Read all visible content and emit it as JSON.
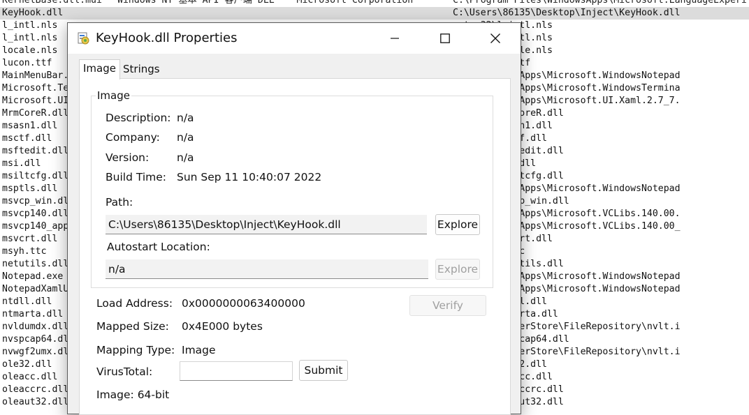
{
  "background_list": {
    "top_row": {
      "name": "KernelBase.dll.mui",
      "description": "Windows NT 基本 API 客户端 DLL",
      "company": "Microsoft Corporation",
      "path": "C:\\Program Files\\WindowsApps\\Microsoft.LanguageExperi"
    },
    "rows": [
      {
        "name": "KeyHook.dll",
        "path": "C:\\Users\\86135\\Desktop\\Inject\\KeyHook.dll",
        "selected": true
      },
      {
        "name": "l_intl.nls",
        "path": "ystem32\\l_intl.nls"
      },
      {
        "name": "l_intl.nls",
        "path": "ystem32\\l_intl.nls"
      },
      {
        "name": "locale.nls",
        "path": "ystem32\\locale.nls"
      },
      {
        "name": "lucon.ttf",
        "path": "onts\\lucon.ttf"
      },
      {
        "name": "MainMenuBar.",
        "path": "iles\\WindowsApps\\Microsoft.WindowsNotepad"
      },
      {
        "name": "Microsoft.Te",
        "path": "iles\\WindowsApps\\Microsoft.WindowsTermina"
      },
      {
        "name": "Microsoft.UI",
        "path": "iles\\WindowsApps\\Microsoft.UI.Xaml.2.7_7."
      },
      {
        "name": "MrmCoreR.dll",
        "path": "ystem32\\MrmCoreR.dll"
      },
      {
        "name": "msasn1.dll",
        "path": "ystem32\\msasn1.dll"
      },
      {
        "name": "msctf.dll",
        "path": "ystem32\\msctf.dll"
      },
      {
        "name": "msftedit.dll",
        "path": "ystem32\\msftedit.dll"
      },
      {
        "name": "msi.dll",
        "path": "ystem32\\msi.dll"
      },
      {
        "name": "msiltcfg.dll",
        "path": "ystem32\\msiltcfg.dll"
      },
      {
        "name": "msptls.dll",
        "path": "iles\\WindowsApps\\Microsoft.WindowsNotepad"
      },
      {
        "name": "msvcp_win.dl",
        "path": "ystem32\\msvcp_win.dll"
      },
      {
        "name": "msvcp140.dll",
        "path": "iles\\WindowsApps\\Microsoft.VCLibs.140.00."
      },
      {
        "name": "msvcp140_app",
        "path": "iles\\WindowsApps\\Microsoft.VCLibs.140.00_"
      },
      {
        "name": "msvcrt.dll",
        "path": "ystem32\\msvcrt.dll"
      },
      {
        "name": "msyh.ttc",
        "path": "onts\\msyh.ttc"
      },
      {
        "name": "netutils.dll",
        "path": "ystem32\\netutils.dll"
      },
      {
        "name": "Notepad.exe",
        "path": "iles\\WindowsApps\\Microsoft.WindowsNotepad"
      },
      {
        "name": "NotepadXamlU",
        "path": "iles\\WindowsApps\\Microsoft.WindowsNotepad"
      },
      {
        "name": "ntdll.dll",
        "path": "ystem32\\ntdll.dll"
      },
      {
        "name": "ntmarta.dll",
        "path": "ystem32\\ntmarta.dll"
      },
      {
        "name": "nvldumdx.dll",
        "path": "ystem32\\DriverStore\\FileRepository\\nvlt.i"
      },
      {
        "name": "nvspcap64.dl",
        "path": "ystem32\\nvspcap64.dll"
      },
      {
        "name": "nvwgf2umx.dl",
        "path": "ystem32\\DriverStore\\FileRepository\\nvlt.i"
      },
      {
        "name": "ole32.dll",
        "path": "ystem32\\ole32.dll"
      },
      {
        "name": "oleacc.dll",
        "path": "ystem32\\oleacc.dll"
      },
      {
        "name": "oleaccrc.dll",
        "path": "ystem32\\oleaccrc.dll"
      },
      {
        "name": "oleaut32.dll",
        "path": "ystem32\\oleaut32.dll"
      }
    ]
  },
  "dialog": {
    "title": "KeyHook.dll Properties",
    "tabs": [
      {
        "label": "Image",
        "active": true
      },
      {
        "label": "Strings",
        "active": false
      }
    ],
    "image_group": {
      "title": "Image",
      "description_label": "Description:",
      "description_value": "n/a",
      "company_label": "Company:",
      "company_value": "n/a",
      "version_label": "Version:",
      "version_value": "n/a",
      "build_time_label": "Build Time:",
      "build_time_value": "Sun Sep 11 10:40:07 2022",
      "path_label": "Path:",
      "path_value": "C:\\Users\\86135\\Desktop\\Inject\\KeyHook.dll",
      "explore_label": "Explore",
      "autostart_label": "Autostart Location:",
      "autostart_value": "n/a",
      "autostart_explore_label": "Explore"
    },
    "load_address_label": "Load Address:",
    "load_address_value": "0x0000000063400000",
    "verify_label": "Verify",
    "mapped_size_label": "Mapped Size:",
    "mapped_size_value": "0x4E000 bytes",
    "mapping_type_label": "Mapping Type:",
    "mapping_type_value": "Image",
    "virustotal_label": "VirusTotal:",
    "virustotal_value": "",
    "submit_label": "Submit",
    "image_bitness": "Image: 64-bit"
  },
  "colors": {
    "selected_row": "#dcdcdc",
    "dialog_client": "#f0f0f0",
    "disabled_text": "#a0a0a0"
  },
  "icons": [
    "dll-app-icon",
    "minimize-icon",
    "maximize-icon",
    "close-icon"
  ]
}
